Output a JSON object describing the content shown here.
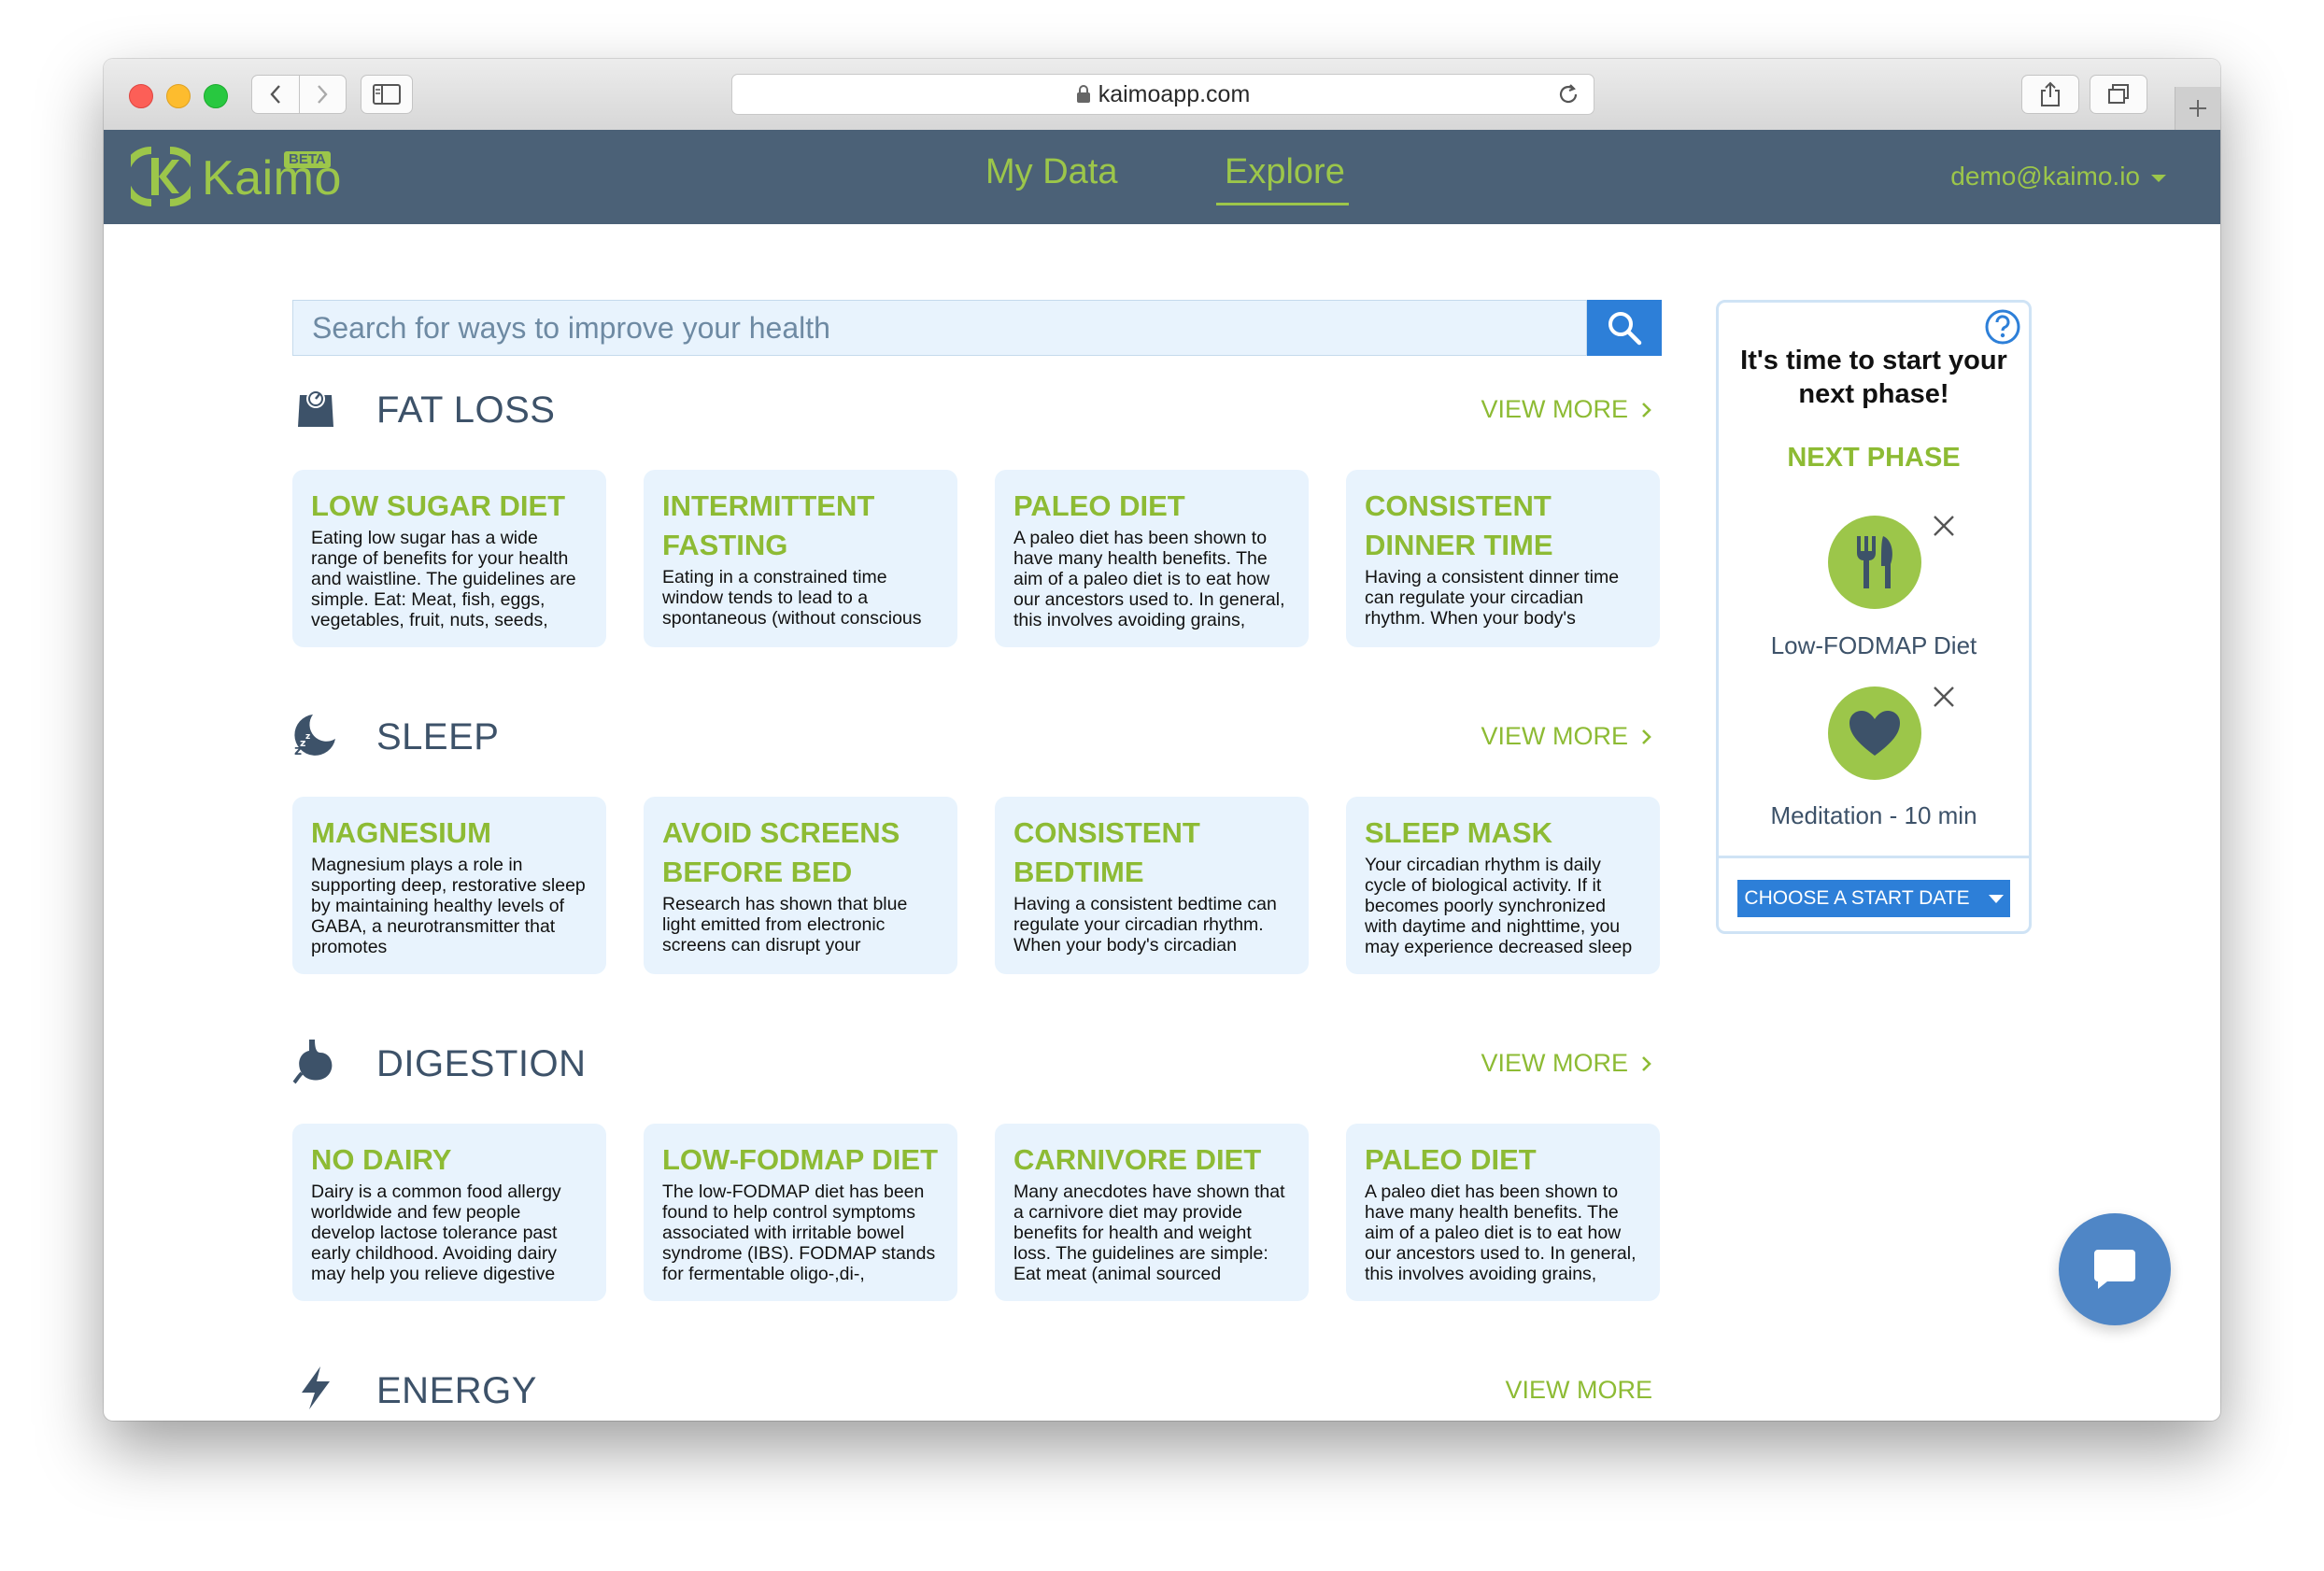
{
  "browser": {
    "url": "kaimoapp.com"
  },
  "navbar": {
    "logo_text": "Kaimo",
    "beta_label": "BETA",
    "links": [
      {
        "label": "My Data"
      },
      {
        "label": "Explore"
      }
    ],
    "active_link": "Explore",
    "user_email": "demo@kaimo.io"
  },
  "search": {
    "placeholder": "Search for ways to improve your health"
  },
  "sections": [
    {
      "title": "FAT LOSS",
      "icon": "scale-icon",
      "view_more": "VIEW MORE",
      "cards": [
        {
          "title": "LOW SUGAR DIET",
          "desc": "Eating low sugar has a wide range of benefits for your health and waistline. The guidelines are simple. Eat: Meat, fish, eggs, vegetables, fruit, nuts, seeds,"
        },
        {
          "title": "INTERMITTENT FASTING",
          "desc": "Eating in a constrained time window tends to lead to a spontaneous (without conscious"
        },
        {
          "title": "PALEO DIET",
          "desc": "A paleo diet has been shown to have many health benefits. The aim of a paleo diet is to eat how our ancestors used to. In general, this involves avoiding grains,"
        },
        {
          "title": "CONSISTENT DINNER TIME",
          "desc": "Having a consistent dinner time can regulate your circadian rhythm. When your body's"
        }
      ]
    },
    {
      "title": "SLEEP",
      "icon": "moon-zzz-icon",
      "view_more": "VIEW MORE",
      "cards": [
        {
          "title": "MAGNESIUM",
          "desc": "Magnesium plays a role in supporting deep, restorative sleep by maintaining healthy levels of GABA, a neurotransmitter that promotes"
        },
        {
          "title": "AVOID SCREENS BEFORE BED",
          "desc": "Research has shown that blue light emitted from electronic screens can disrupt your"
        },
        {
          "title": "CONSISTENT BEDTIME",
          "desc": "Having a consistent bedtime can regulate your circadian rhythm. When your body's circadian"
        },
        {
          "title": "SLEEP MASK",
          "desc": "Your circadian rhythm is daily cycle of biological activity. If it becomes poorly synchronized with daytime and nighttime, you may experience decreased sleep"
        }
      ]
    },
    {
      "title": "DIGESTION",
      "icon": "stomach-icon",
      "view_more": "VIEW MORE",
      "cards": [
        {
          "title": "NO DAIRY",
          "desc": "Dairy is a common food allergy worldwide and few people develop lactose tolerance past early childhood. Avoiding dairy may help you relieve digestive"
        },
        {
          "title": "LOW-FODMAP DIET",
          "desc": "The low-FODMAP diet has been found to help control symptoms associated with irritable bowel syndrome (IBS). FODMAP stands for fermentable oligo-,di-,"
        },
        {
          "title": "CARNIVORE DIET",
          "desc": "Many anecdotes have shown that a carnivore diet may provide benefits for health and weight loss. The guidelines are simple: Eat meat (animal sourced"
        },
        {
          "title": "PALEO DIET",
          "desc": "A paleo diet has been shown to have many health benefits. The aim of a paleo diet is to eat how our ancestors used to. In general, this involves avoiding grains,"
        }
      ]
    }
  ],
  "cut_section": {
    "title": "ENERGY",
    "view_more": "VIEW MORE"
  },
  "phase_widget": {
    "heading": "It's time to start your next phase!",
    "subheading": "NEXT PHASE",
    "items": [
      {
        "label": "Low-FODMAP Diet",
        "icon": "fork-knife-icon"
      },
      {
        "label": "Meditation - 10 min",
        "icon": "heart-icon"
      }
    ],
    "button_label": "CHOOSE A START DATE"
  },
  "colors": {
    "navbar": "#4b6177",
    "accent_green": "#8dbb34",
    "primary_blue": "#2d7fd8",
    "card_bg": "#e8f3fd"
  }
}
